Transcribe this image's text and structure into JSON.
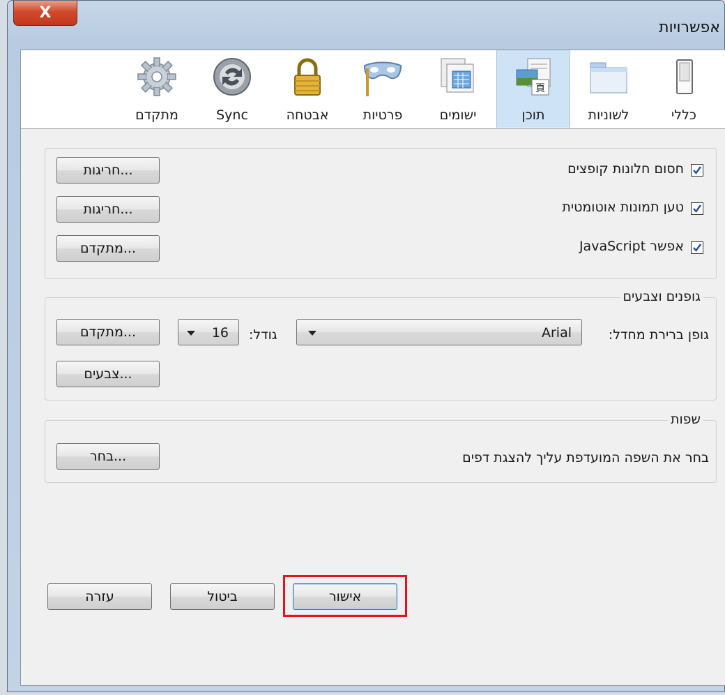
{
  "window": {
    "title": "אפשרויות",
    "close_label": "X"
  },
  "toolbar": {
    "tabs": [
      {
        "label": "כללי",
        "icon": "switch-icon"
      },
      {
        "label": "לשוניות",
        "icon": "tabs-icon"
      },
      {
        "label": "תוכן",
        "icon": "content-icon",
        "selected": true
      },
      {
        "label": "ישומים",
        "icon": "applications-icon"
      },
      {
        "label": "פרטיות",
        "icon": "privacy-mask-icon"
      },
      {
        "label": "אבטחה",
        "icon": "padlock-icon"
      },
      {
        "label": "Sync",
        "icon": "sync-icon"
      },
      {
        "label": "מתקדם",
        "icon": "gear-icon"
      }
    ]
  },
  "content_group": {
    "block_popups": {
      "label": "חסום חלונות קופצים",
      "checked": true,
      "button": "חריגות..."
    },
    "load_images": {
      "label": "טען תמונות אוטומטית",
      "checked": true,
      "button": "חריגות..."
    },
    "enable_js": {
      "label": "אפשר JavaScript",
      "checked": true,
      "button": "מתקדם..."
    }
  },
  "fonts_group": {
    "legend": "גופנים וצבעים",
    "default_font_label": "גופן ברירת מחדל:",
    "default_font_value": "Arial",
    "size_label": "גודל:",
    "size_value": "16",
    "advanced_button": "מתקדם...",
    "colors_button": "צבעים..."
  },
  "languages_group": {
    "legend": "שפות",
    "description": "בחר את השפה המועדפת עליך להצגת דפים",
    "choose_button": "בחר..."
  },
  "footer": {
    "ok": "אישור",
    "cancel": "ביטול",
    "help": "עזרה"
  },
  "colors": {
    "highlight": "#e5141c",
    "selected_tab": "#cfe3f6"
  }
}
